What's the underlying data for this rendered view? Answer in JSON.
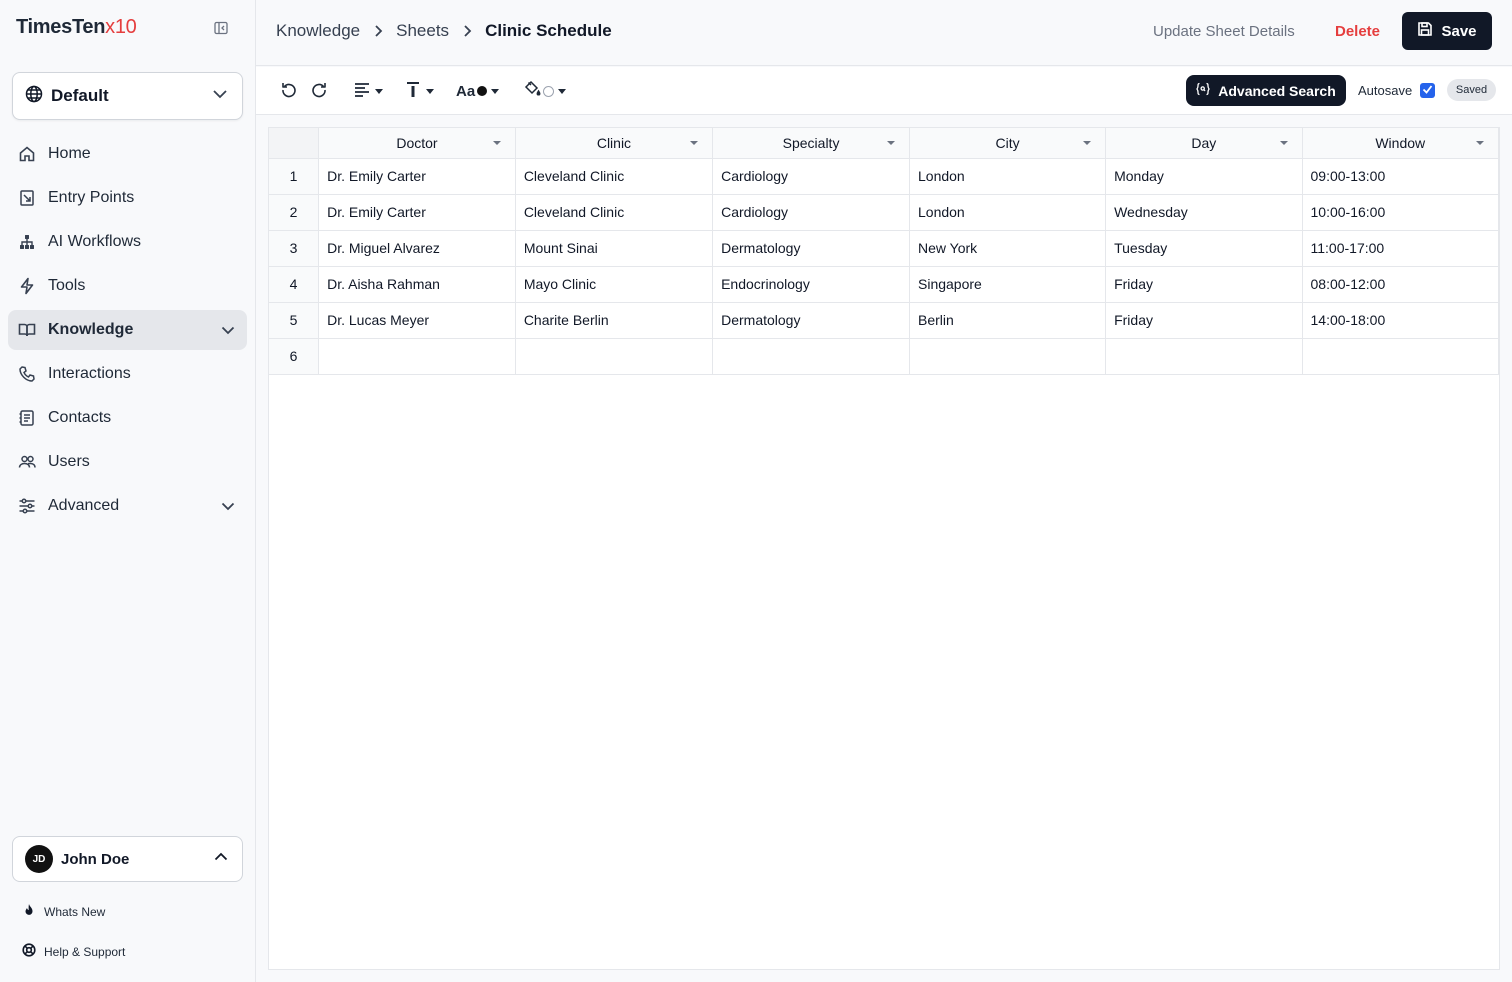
{
  "brand": {
    "name": "TimesTen",
    "suffix": "x10"
  },
  "workspace": {
    "label": "Default"
  },
  "nav": [
    {
      "label": "Home",
      "icon": "home-icon"
    },
    {
      "label": "Entry Points",
      "icon": "entry-points-icon"
    },
    {
      "label": "AI Workflows",
      "icon": "workflow-icon"
    },
    {
      "label": "Tools",
      "icon": "lightning-icon"
    },
    {
      "label": "Knowledge",
      "icon": "book-icon",
      "active": true
    },
    {
      "label": "Interactions",
      "icon": "phone-icon"
    },
    {
      "label": "Contacts",
      "icon": "contacts-icon"
    },
    {
      "label": "Users",
      "icon": "users-icon"
    },
    {
      "label": "Advanced",
      "icon": "sliders-icon"
    }
  ],
  "user": {
    "initials": "JD",
    "name": "John Doe"
  },
  "footer": {
    "whats_new": "Whats New",
    "help": "Help & Support"
  },
  "breadcrumb": [
    "Knowledge",
    "Sheets",
    "Clinic Schedule"
  ],
  "header": {
    "update": "Update Sheet Details",
    "delete": "Delete",
    "save": "Save"
  },
  "toolbar": {
    "font_label": "Aa",
    "advanced_search": "Advanced Search",
    "autosave": "Autosave",
    "autosave_checked": true,
    "saved": "Saved"
  },
  "colors": {
    "accent": "#e53e3e",
    "dark": "#111827",
    "checkbox": "#2563eb"
  },
  "grid": {
    "columns": [
      "Doctor",
      "Clinic",
      "Specialty",
      "City",
      "Day",
      "Window"
    ],
    "rows": [
      [
        "Dr. Emily Carter",
        "Cleveland Clinic",
        "Cardiology",
        "London",
        "Monday",
        "09:00-13:00"
      ],
      [
        "Dr. Emily Carter",
        "Cleveland Clinic",
        "Cardiology",
        "London",
        "Wednesday",
        "10:00-16:00"
      ],
      [
        "Dr. Miguel Alvarez",
        "Mount Sinai",
        "Dermatology",
        "New York",
        "Tuesday",
        "11:00-17:00"
      ],
      [
        "Dr. Aisha Rahman",
        "Mayo Clinic",
        "Endocrinology",
        "Singapore",
        "Friday",
        "08:00-12:00"
      ],
      [
        "Dr. Lucas Meyer",
        "Charite Berlin",
        "Dermatology",
        "Berlin",
        "Friday",
        "14:00-18:00"
      ],
      [
        "",
        "",
        "",
        "",
        "",
        ""
      ]
    ]
  }
}
